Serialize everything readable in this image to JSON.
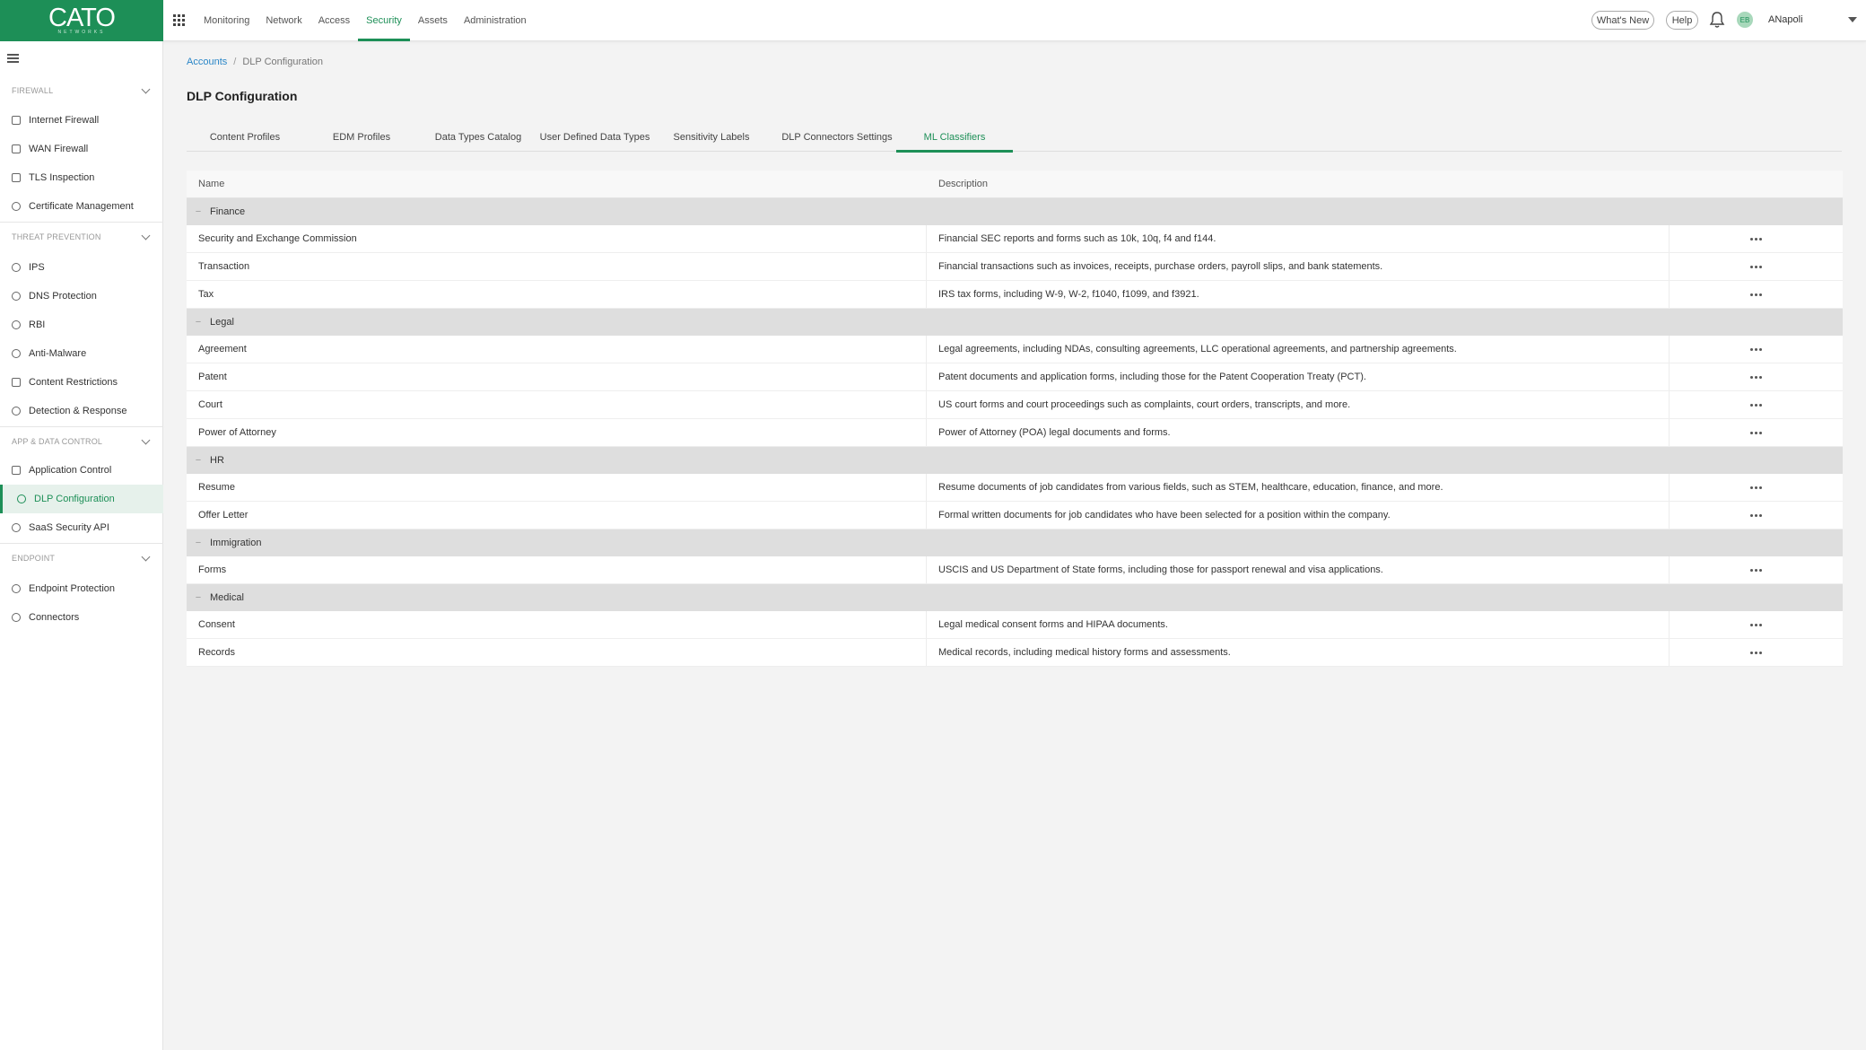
{
  "brand": {
    "name": "CATO",
    "sub": "NETWORKS",
    "color": "#1d8f57"
  },
  "topnav": {
    "items": [
      "Monitoring",
      "Network",
      "Access",
      "Security",
      "Assets",
      "Administration"
    ],
    "active": "Security",
    "whats_new": "What's New",
    "help": "Help",
    "avatar_initials": "EB",
    "username": "ANapoli"
  },
  "sidebar": {
    "sections": [
      {
        "title": "FIREWALL",
        "items": [
          "Internet Firewall",
          "WAN Firewall",
          "TLS Inspection",
          "Certificate Management"
        ]
      },
      {
        "title": "THREAT PREVENTION",
        "items": [
          "IPS",
          "DNS Protection",
          "RBI",
          "Anti-Malware",
          "Content Restrictions",
          "Detection & Response"
        ]
      },
      {
        "title": "APP & DATA CONTROL",
        "items": [
          "Application Control",
          "DLP Configuration",
          "SaaS Security API"
        ]
      },
      {
        "title": "ENDPOINT",
        "items": [
          "Endpoint Protection",
          "Connectors"
        ]
      }
    ],
    "active_item": "DLP Configuration"
  },
  "breadcrumb": {
    "root": "Accounts",
    "current": "DLP Configuration"
  },
  "page_title": "DLP Configuration",
  "tabs": [
    "Content Profiles",
    "EDM Profiles",
    "Data Types Catalog",
    "User Defined Data Types",
    "Sensitivity Labels",
    "DLP Connectors Settings",
    "ML Classifiers"
  ],
  "active_tab": "ML Classifiers",
  "table": {
    "columns": [
      "Name",
      "Description"
    ],
    "groups": [
      {
        "name": "Finance",
        "rows": [
          {
            "name": "Security and Exchange Commission",
            "description": "Financial SEC reports and forms such as 10k, 10q, f4 and f144."
          },
          {
            "name": "Transaction",
            "description": "Financial transactions such as invoices, receipts, purchase orders, payroll slips, and bank statements."
          },
          {
            "name": "Tax",
            "description": "IRS tax forms, including W-9, W-2, f1040, f1099, and f3921."
          }
        ]
      },
      {
        "name": "Legal",
        "rows": [
          {
            "name": "Agreement",
            "description": "Legal agreements, including NDAs, consulting agreements, LLC operational agreements, and partnership agreements."
          },
          {
            "name": "Patent",
            "description": "Patent documents and application forms, including those for the Patent Cooperation Treaty (PCT)."
          },
          {
            "name": "Court",
            "description": "US court forms and court proceedings such as complaints, court orders, transcripts, and more."
          },
          {
            "name": "Power of Attorney",
            "description": "Power of Attorney (POA) legal documents and forms."
          }
        ]
      },
      {
        "name": "HR",
        "rows": [
          {
            "name": "Resume",
            "description": "Resume documents of job candidates from various fields, such as STEM, healthcare, education, finance, and more."
          },
          {
            "name": "Offer Letter",
            "description": "Formal written documents for job candidates who have been selected for a position within the company."
          }
        ]
      },
      {
        "name": "Immigration",
        "rows": [
          {
            "name": "Forms",
            "description": "USCIS and US Department of State forms, including those for passport renewal and visa applications."
          }
        ]
      },
      {
        "name": "Medical",
        "rows": [
          {
            "name": "Consent",
            "description": "Legal medical consent forms and HIPAA documents."
          },
          {
            "name": "Records",
            "description": "Medical records, including medical history forms and assessments."
          }
        ]
      }
    ]
  }
}
